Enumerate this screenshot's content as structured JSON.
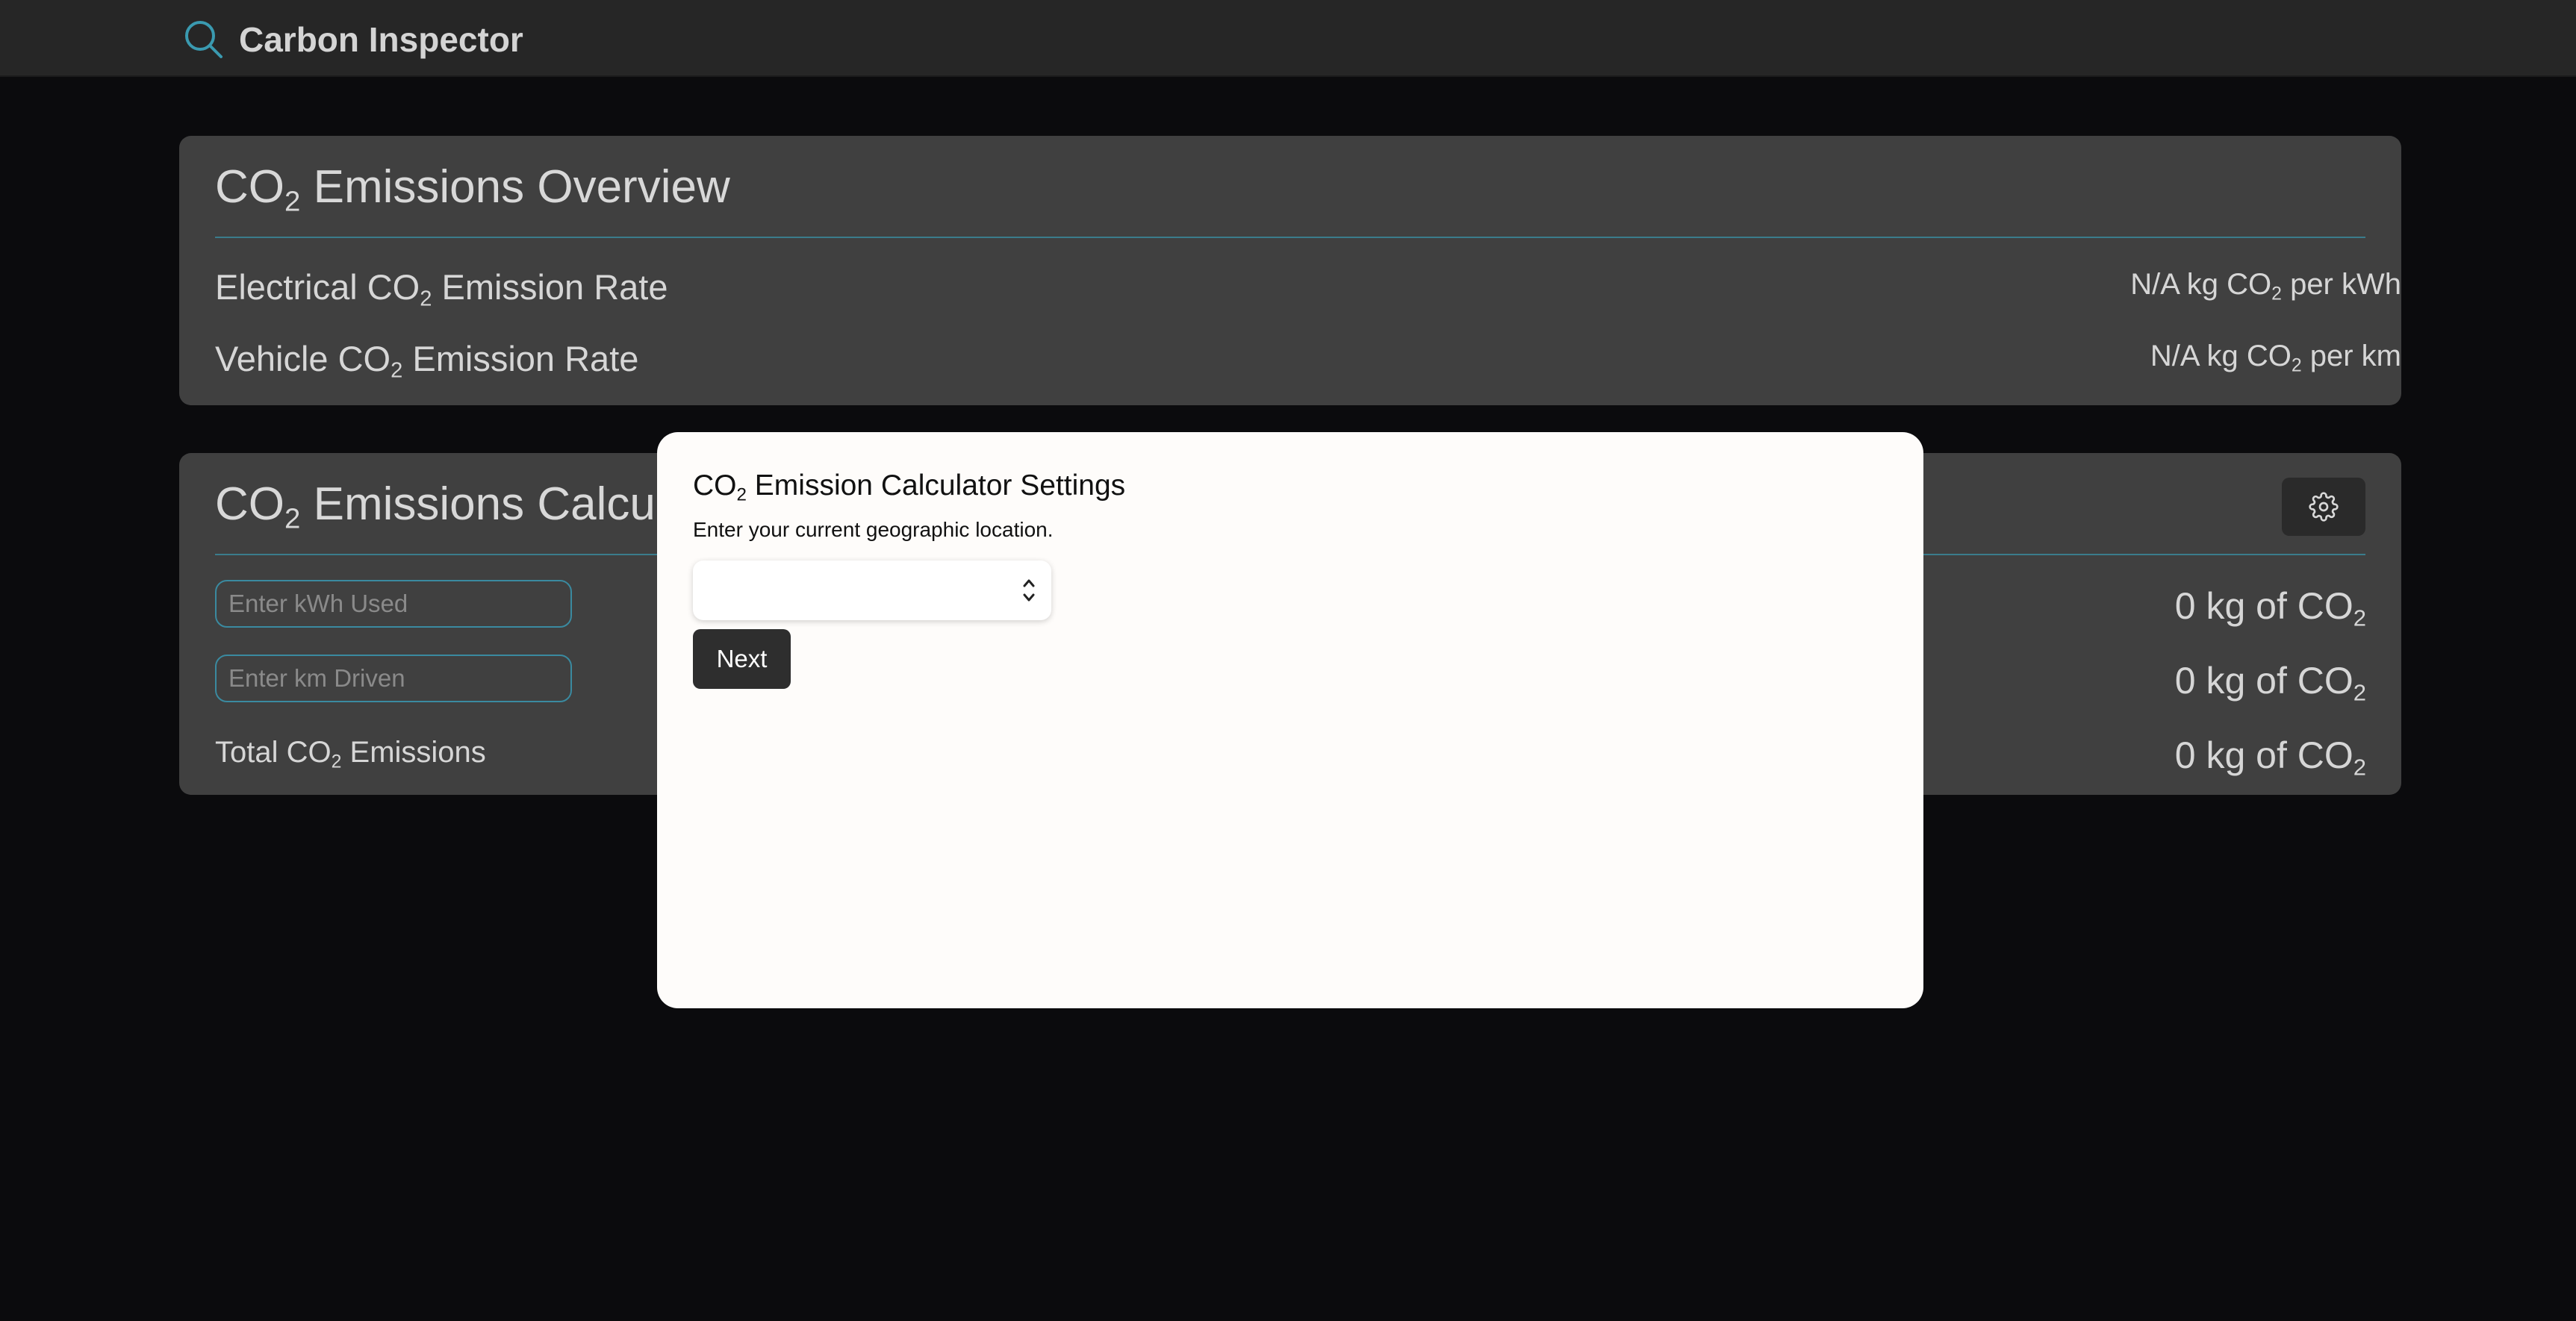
{
  "header": {
    "title": "Carbon Inspector"
  },
  "overview": {
    "title_prefix": "CO",
    "title_sub": "2",
    "title_suffix": " Emissions Overview",
    "electrical": {
      "label_prefix": "Electrical CO",
      "label_sub": "2",
      "label_suffix": " Emission Rate",
      "value_prefix": "N/A kg CO",
      "value_sub": "2",
      "value_suffix": " per kWh"
    },
    "vehicle": {
      "label_prefix": "Vehicle CO",
      "label_sub": "2",
      "label_suffix": " Emission Rate",
      "value_prefix": "N/A kg CO",
      "value_sub": "2",
      "value_suffix": " per km"
    }
  },
  "calculator": {
    "title_prefix": "CO",
    "title_sub": "2",
    "title_suffix": " Emissions Calcula",
    "kwh_placeholder": "Enter kWh Used",
    "km_placeholder": "Enter km Driven",
    "total_prefix": "Total CO",
    "total_sub": "2",
    "total_suffix": " Emissions",
    "results": [
      {
        "prefix": "0 kg of CO",
        "sub": "2"
      },
      {
        "prefix": "0 kg of CO",
        "sub": "2"
      },
      {
        "prefix": "0 kg of CO",
        "sub": "2"
      }
    ]
  },
  "modal": {
    "title_prefix": "CO",
    "title_sub": "2",
    "title_suffix": " Emission Calculator Settings",
    "description": "Enter your current geographic location.",
    "select_value": "",
    "next_label": "Next"
  },
  "colors": {
    "accent": "#3a8aa0",
    "card_bg": "#404040",
    "page_bg": "#0b0b0d",
    "modal_bg": "#fefcfa"
  },
  "icons": {
    "brand": "search-icon",
    "settings": "gear-icon",
    "select": "chevron-up-down-icon"
  }
}
